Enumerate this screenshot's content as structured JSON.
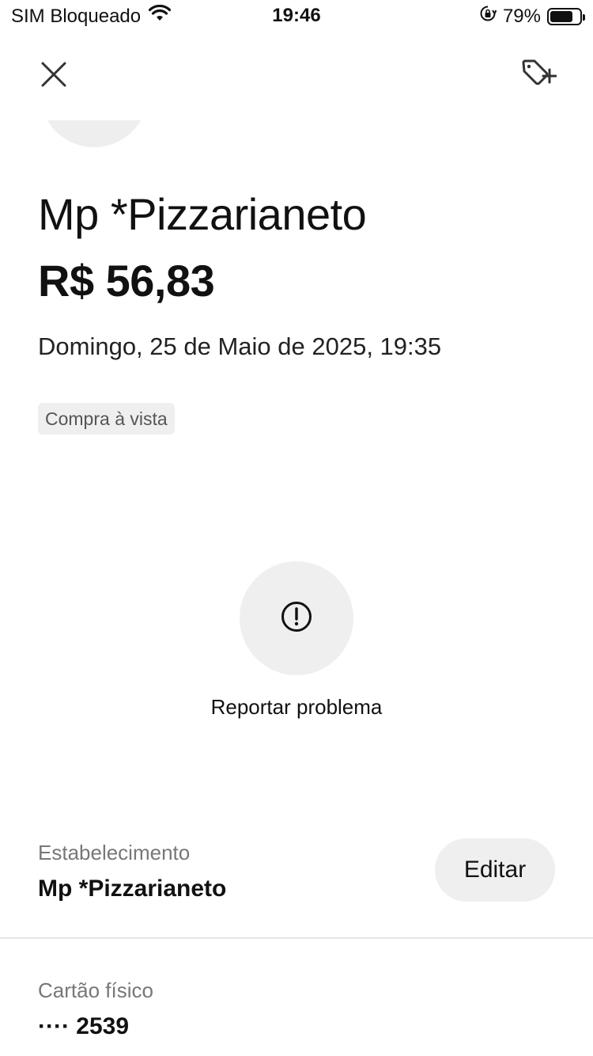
{
  "status_bar": {
    "carrier": "SIM Bloqueado",
    "time": "19:46",
    "battery_percent": "79%",
    "battery_level": 0.79,
    "icons": [
      "wifi-icon",
      "orientation-lock-icon",
      "battery-icon"
    ]
  },
  "nav": {
    "close_icon": "close-icon",
    "tag_icon": "tag-add-icon"
  },
  "transaction": {
    "merchant": "Mp *Pizzarianeto",
    "amount": "R$ 56,83",
    "datetime": "Domingo, 25 de Maio de 2025, 19:35",
    "type_badge": "Compra à vista"
  },
  "report": {
    "icon": "alert-circle-icon",
    "label": "Reportar problema"
  },
  "details": {
    "establishment_label": "Estabelecimento",
    "establishment_value": "Mp *Pizzarianeto",
    "edit_label": "Editar",
    "card_label": "Cartão físico",
    "card_value": "···· 2539"
  },
  "colors": {
    "background": "#ffffff",
    "text_primary": "#111111",
    "text_secondary": "#777777",
    "chip_background": "#efefef"
  }
}
